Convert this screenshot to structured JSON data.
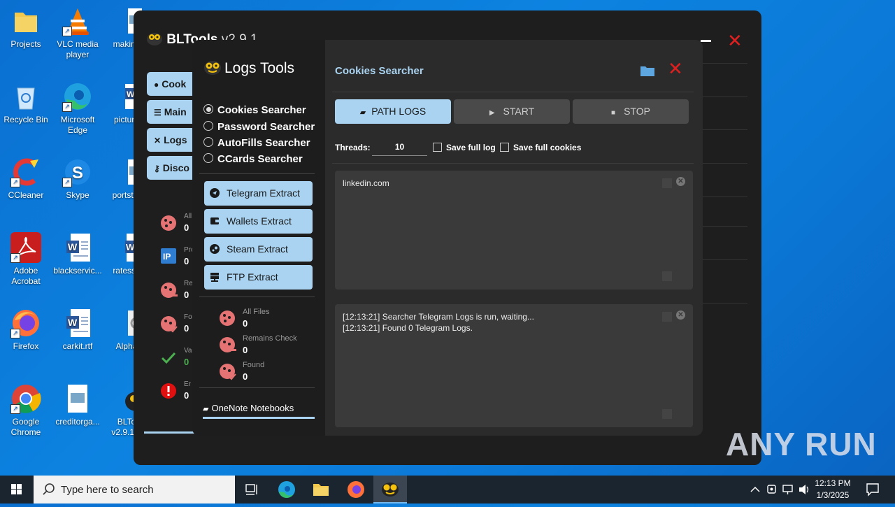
{
  "desktop": {
    "icons": [
      {
        "label": "Projects",
        "icon": "folder-icon"
      },
      {
        "label": "VLC media player",
        "icon": "vlc-icon"
      },
      {
        "label": "making",
        "icon": "image-file-icon"
      },
      {
        "label": "Recycle Bin",
        "icon": "recycle-bin-icon"
      },
      {
        "label": "Microsoft Edge",
        "icon": "edge-icon"
      },
      {
        "label": "picture",
        "icon": "word-doc-icon"
      },
      {
        "label": "CCleaner",
        "icon": "ccleaner-icon"
      },
      {
        "label": "Skype",
        "icon": "skype-icon"
      },
      {
        "label": "portstar",
        "icon": "image-file-icon"
      },
      {
        "label": "Adobe Acrobat",
        "icon": "acrobat-icon"
      },
      {
        "label": "blackservic...",
        "icon": "word-doc-icon"
      },
      {
        "label": "ratesse",
        "icon": "word-doc-icon"
      },
      {
        "label": "Firefox",
        "icon": "firefox-icon"
      },
      {
        "label": "carkit.rtf",
        "icon": "word-doc-icon"
      },
      {
        "label": "Alpha",
        "icon": "gear-icon"
      },
      {
        "label": "Google Chrome",
        "icon": "chrome-icon"
      },
      {
        "label": "creditorga...",
        "icon": "image-file-icon"
      },
      {
        "label": "BLTo v2.9.1[F",
        "icon": "bltools-icon"
      }
    ]
  },
  "main_window": {
    "title": "BLTools",
    "version": "v2.9.1",
    "sidebar": [
      {
        "label": "Cook",
        "icon": "cookie-icon"
      },
      {
        "label": "Main",
        "icon": "sliders-icon"
      },
      {
        "label": "Logs",
        "icon": "tools-icon"
      },
      {
        "label": "Disco",
        "icon": "key-icon"
      }
    ],
    "stats": [
      {
        "label": "All",
        "value": "0",
        "icon": "cookie-icon"
      },
      {
        "label": "Pro",
        "value": "0",
        "icon": "ip-icon"
      },
      {
        "label": "Re",
        "value": "0",
        "icon": "cookie-minus-icon"
      },
      {
        "label": "Fo",
        "value": "0",
        "icon": "cookie-check-icon"
      },
      {
        "label": "Va",
        "value": "0",
        "icon": "checkmark-icon"
      },
      {
        "label": "Er",
        "value": "0",
        "icon": "error-icon"
      }
    ]
  },
  "logs_window": {
    "title": "Logs Tools",
    "modes": [
      {
        "label": "Cookies Searcher",
        "selected": true
      },
      {
        "label": "Password Searcher",
        "selected": false
      },
      {
        "label": "AutoFills Searcher",
        "selected": false
      },
      {
        "label": "CCards Searcher",
        "selected": false
      }
    ],
    "extract_buttons": [
      {
        "label": "Telegram Extract",
        "icon": "telegram-icon"
      },
      {
        "label": "Wallets Extract",
        "icon": "wallet-icon"
      },
      {
        "label": "Steam Extract",
        "icon": "steam-icon"
      },
      {
        "label": "FTP Extract",
        "icon": "server-icon"
      }
    ],
    "stats": [
      {
        "label": "All Files",
        "value": "0"
      },
      {
        "label": "Remains Check",
        "value": "0"
      },
      {
        "label": "Found",
        "value": "0"
      }
    ],
    "footer_item": "OneNote Notebooks",
    "panel_title": "Cookies Searcher",
    "buttons": {
      "path_logs": "PATH LOGS",
      "start": "START",
      "stop": "STOP"
    },
    "threads_label": "Threads:",
    "threads_value": "10",
    "save_full_log": "Save full log",
    "save_full_cookies": "Save full cookies",
    "query_text": "linkedin.com",
    "log_output": "[12:13:21] Searcher Telegram Logs is run, waiting...\n[12:13:21] Found 0 Telegram Logs."
  },
  "taskbar": {
    "search_placeholder": "Type here to search",
    "time": "12:13 PM",
    "date": "1/3/2025"
  },
  "watermark": "ANY RUN",
  "colors": {
    "accent": "#a9d3f0",
    "close": "#e02020",
    "cookie": "#e57373"
  }
}
